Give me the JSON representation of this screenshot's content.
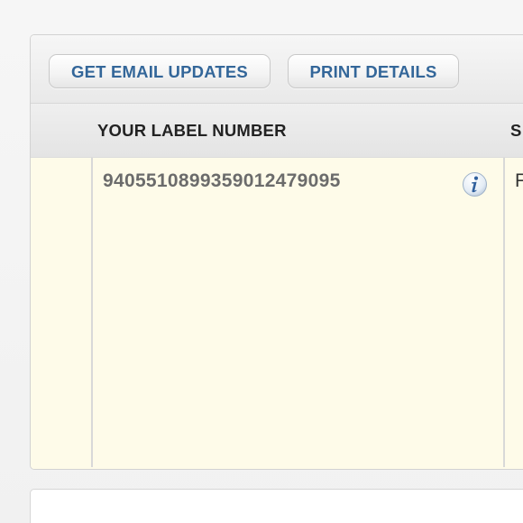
{
  "toolbar": {
    "email_label": "GET EMAIL UPDATES",
    "print_label": "PRINT DETAILS"
  },
  "table": {
    "headers": [
      "YOUR LABEL NUMBER",
      "S"
    ],
    "rows": [
      {
        "label_number": "9405510899359012479095",
        "next_cell": "F"
      }
    ]
  },
  "icons": {
    "info": "info-icon"
  },
  "colors": {
    "button_text": "#336699",
    "row_background": "#fefbe9",
    "info_icon_blue": "#2f5f9c"
  }
}
